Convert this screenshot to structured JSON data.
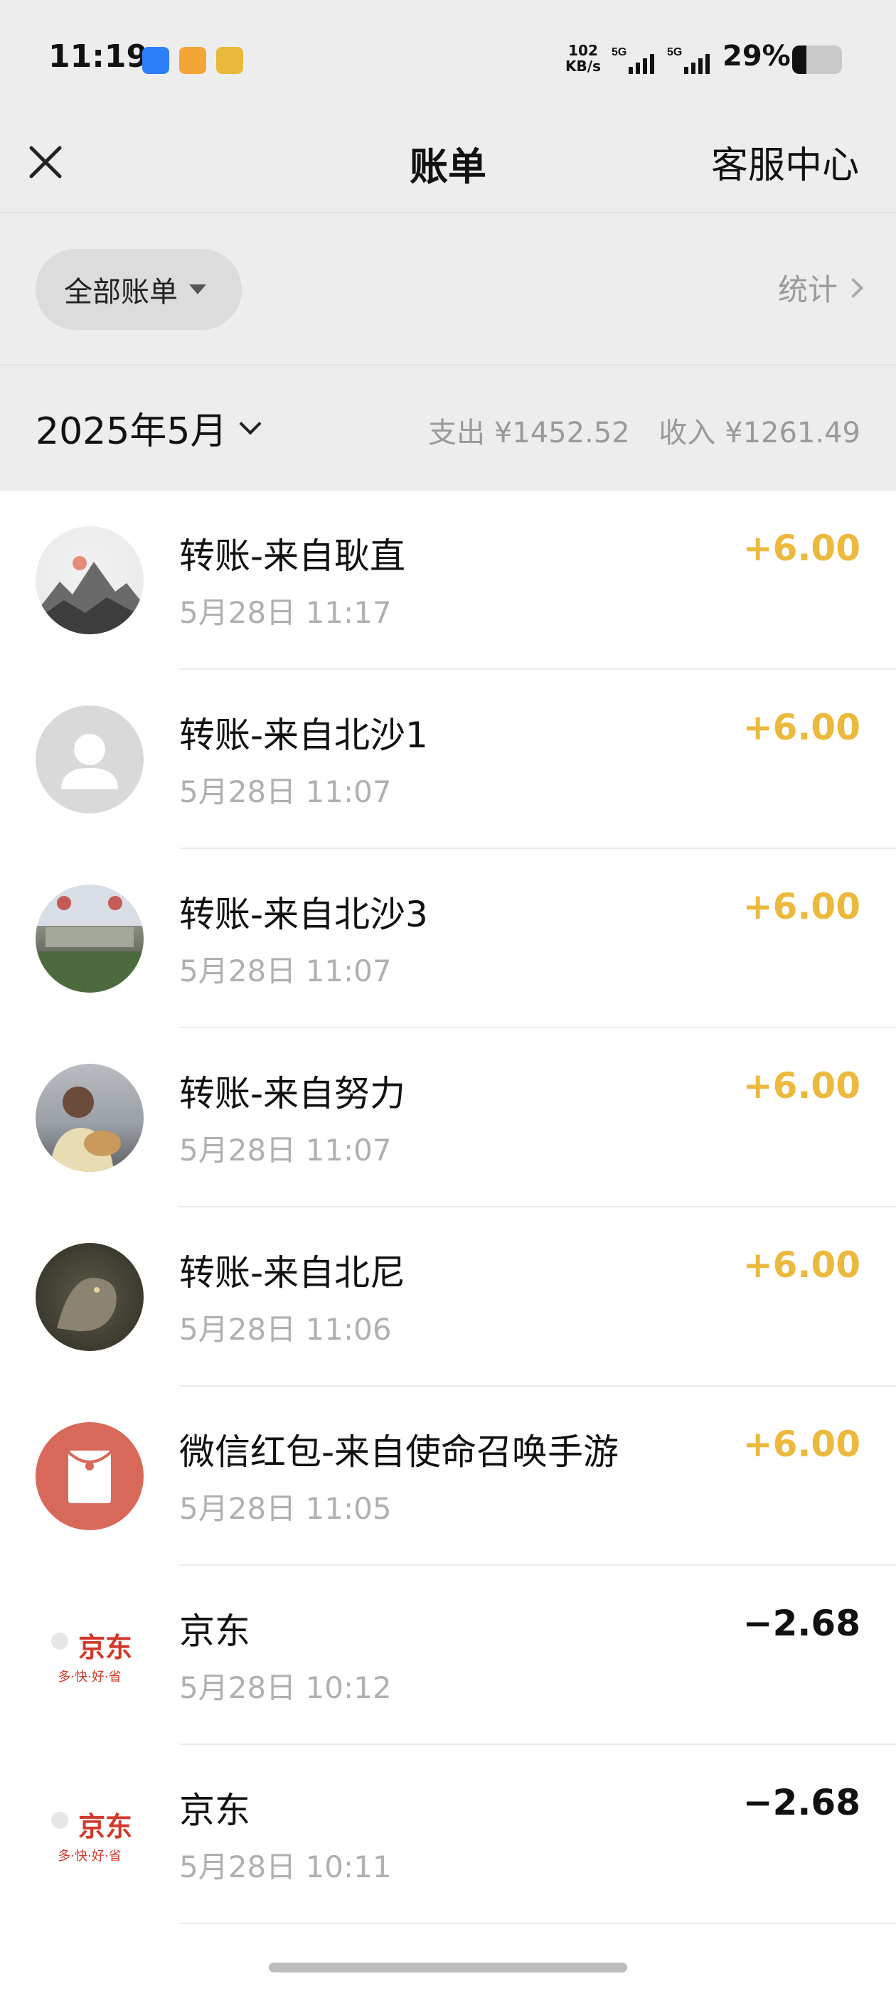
{
  "status_bar": {
    "time": "11:19",
    "net_speed_value": "102",
    "net_speed_unit": "KB/s",
    "signal1_label": "5G",
    "signal2_label": "5G",
    "battery_percent": "29%",
    "battery_level": 0.29
  },
  "nav": {
    "title": "账单",
    "right_label": "客服中心",
    "close_icon": "close-icon"
  },
  "filter": {
    "label": "全部账单",
    "stats_label": "统计"
  },
  "month": {
    "label": "2025年5月",
    "expense": "支出 ¥1452.52",
    "income": "收入 ¥1261.49"
  },
  "colors": {
    "income": "#ecb93c",
    "expense": "#111111",
    "background": "#ededed",
    "jd_red": "#d2392b"
  },
  "bills": [
    {
      "title": "转账-来自耿直",
      "time": "5月28日 11:17",
      "amount": "+6.00",
      "type": "income",
      "avatar": "landscape-painting"
    },
    {
      "title": "转账-来自北沙1",
      "time": "5月28日 11:07",
      "amount": "+6.00",
      "type": "income",
      "avatar": "default-user"
    },
    {
      "title": "转账-来自北沙3",
      "time": "5月28日 11:07",
      "amount": "+6.00",
      "type": "income",
      "avatar": "building-photo"
    },
    {
      "title": "转账-来自努力",
      "time": "5月28日 11:07",
      "amount": "+6.00",
      "type": "income",
      "avatar": "person-photo"
    },
    {
      "title": "转账-来自北尼",
      "time": "5月28日 11:06",
      "amount": "+6.00",
      "type": "income",
      "avatar": "dragon-art"
    },
    {
      "title": "微信红包-来自使命召唤手游",
      "time": "5月28日 11:05",
      "amount": "+6.00",
      "type": "income",
      "avatar": "red-packet"
    },
    {
      "title": "京东",
      "time": "5月28日 10:12",
      "amount": "−2.68",
      "type": "expense",
      "avatar": "jd-logo",
      "logo_text": "京东",
      "logo_sub": "多·快·好·省"
    },
    {
      "title": "京东",
      "time": "5月28日 10:11",
      "amount": "−2.68",
      "type": "expense",
      "avatar": "jd-logo",
      "logo_text": "京东",
      "logo_sub": "多·快·好·省"
    }
  ]
}
